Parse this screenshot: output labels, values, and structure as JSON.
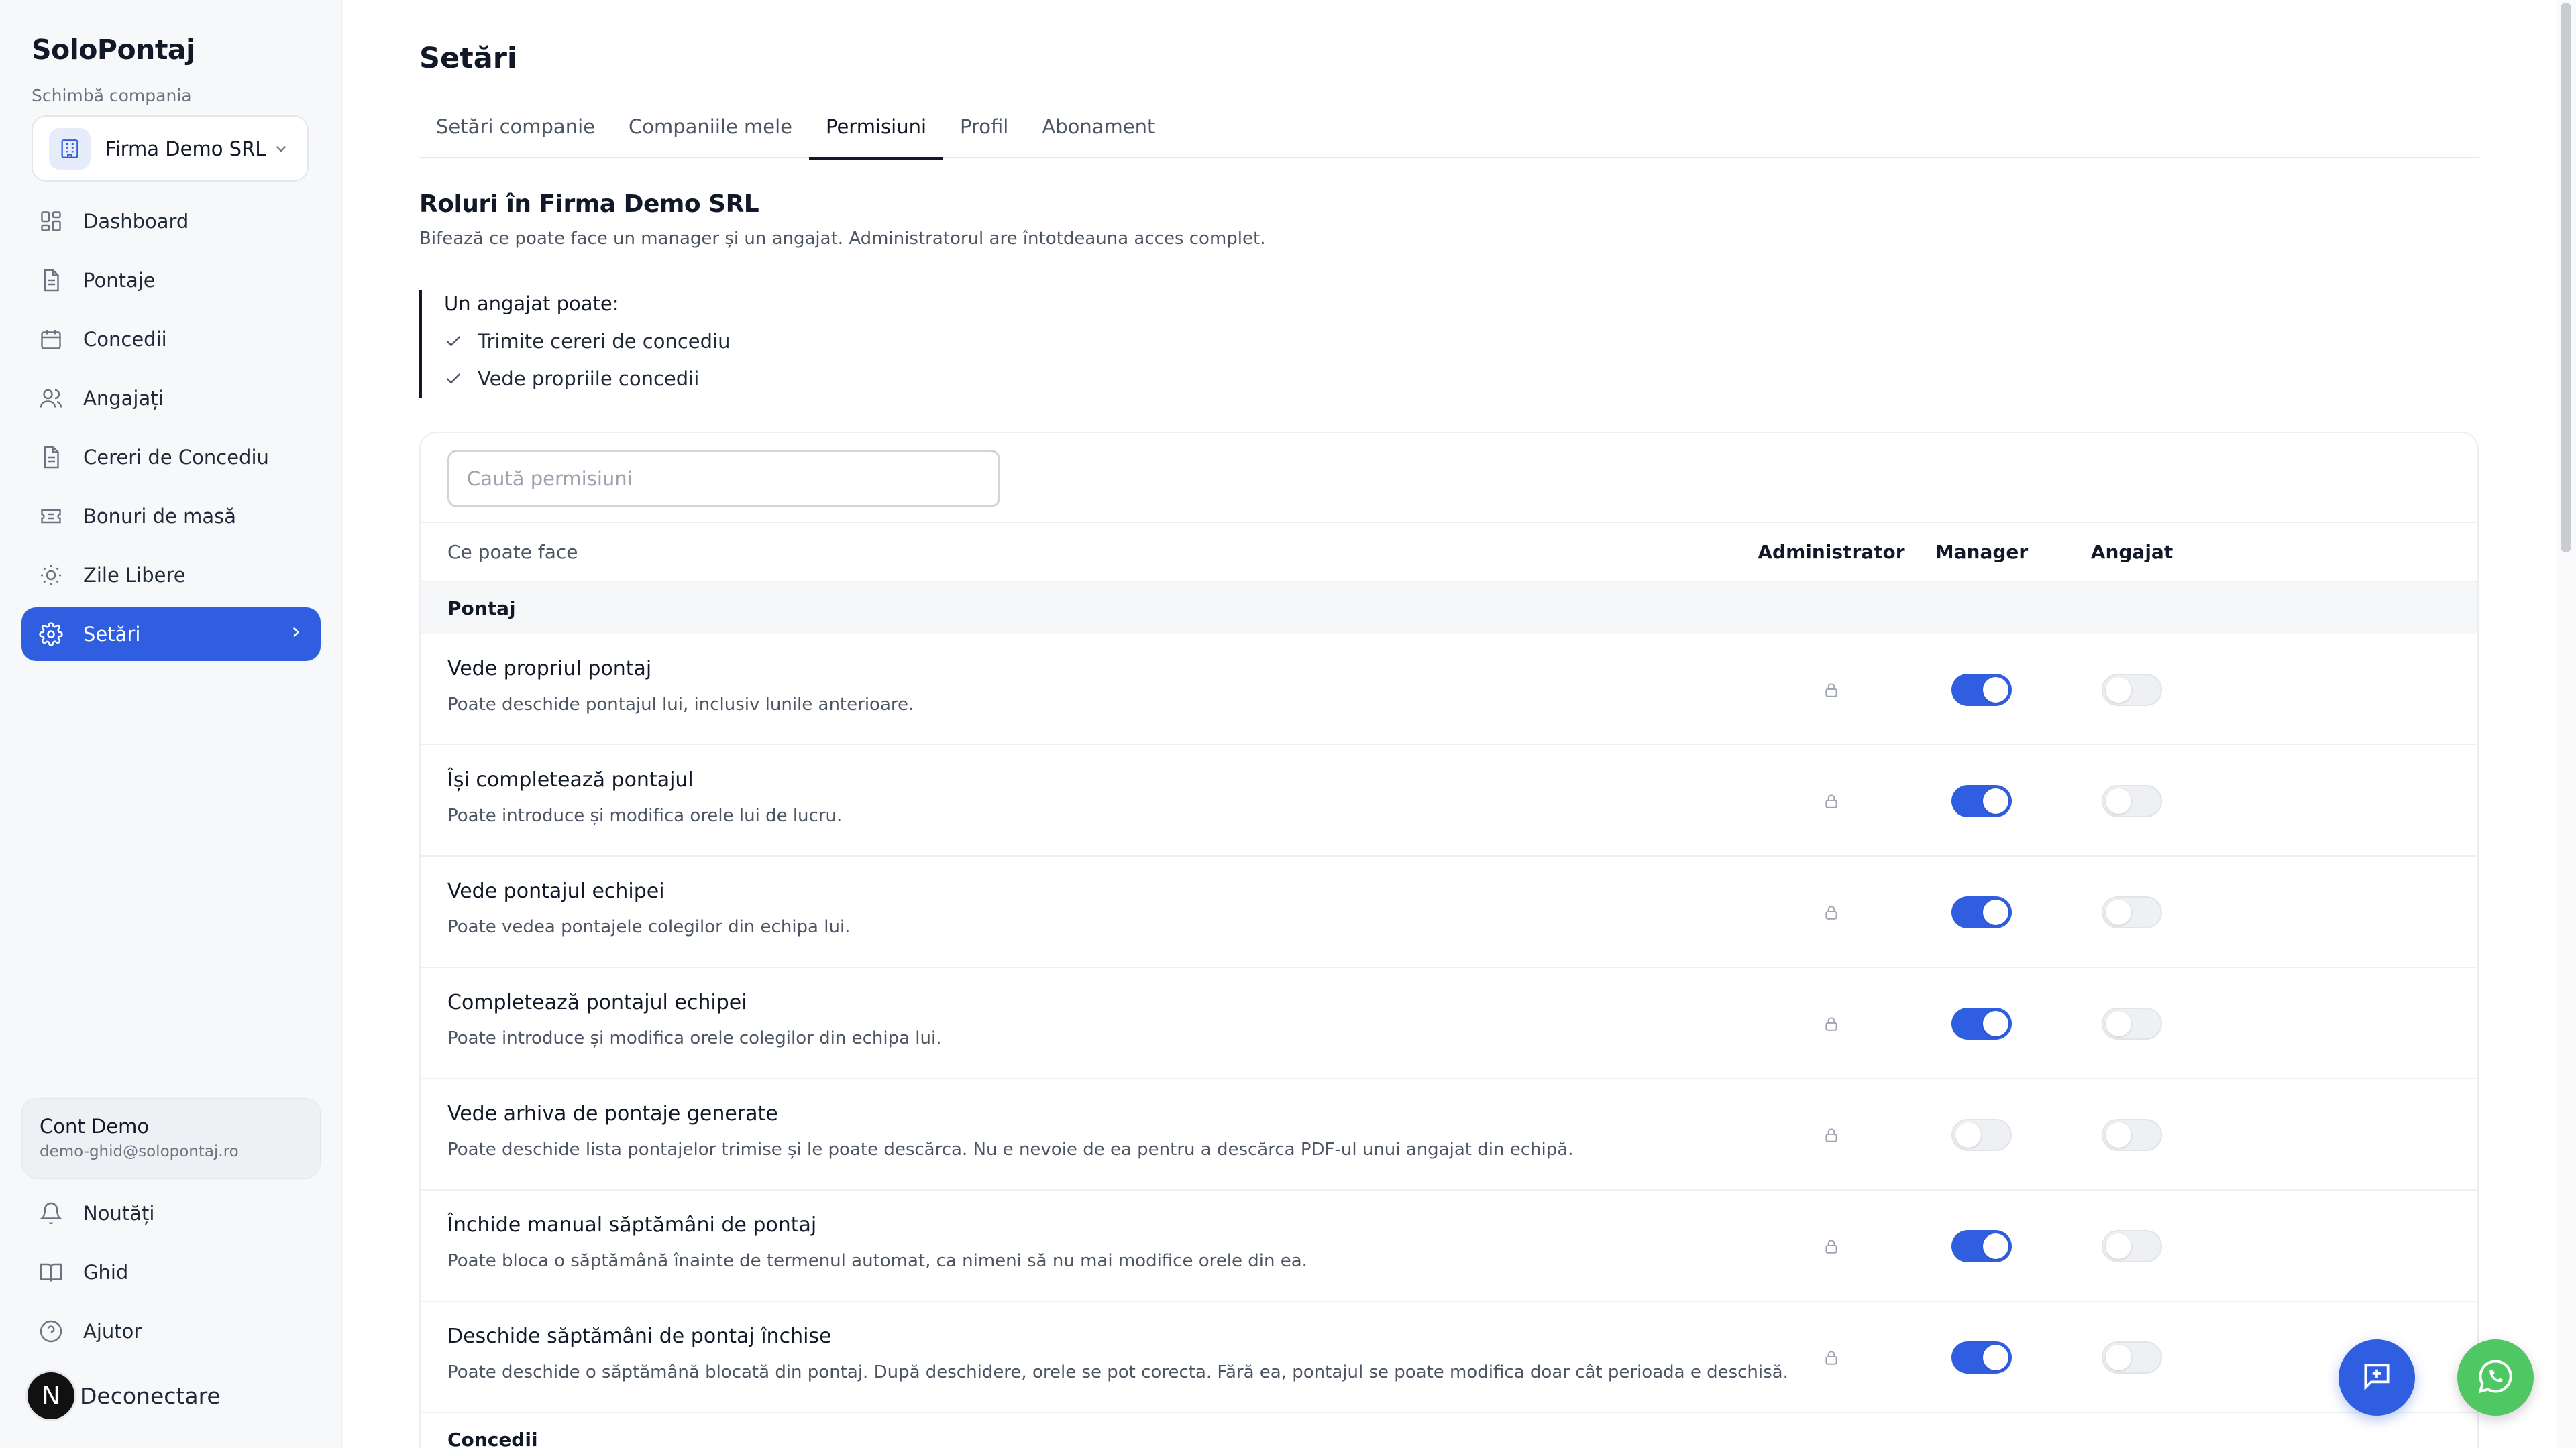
{
  "app": {
    "brand": "SoloPontaj",
    "company_caption": "Schimbă compania",
    "company_name": "Firma Demo SRL"
  },
  "sidebar": {
    "items": [
      {
        "label": "Dashboard",
        "icon": "dashboard-icon"
      },
      {
        "label": "Pontaje",
        "icon": "document-icon"
      },
      {
        "label": "Concedii",
        "icon": "calendar-icon"
      },
      {
        "label": "Angajați",
        "icon": "users-icon"
      },
      {
        "label": "Cereri de Concediu",
        "icon": "document-icon"
      },
      {
        "label": "Bonuri de masă",
        "icon": "ticket-icon"
      },
      {
        "label": "Zile Libere",
        "icon": "sun-icon"
      },
      {
        "label": "Setări",
        "icon": "gear-icon",
        "active": true
      }
    ],
    "account": {
      "name": "Cont Demo",
      "email": "demo-ghid@solopontaj.ro"
    },
    "bottom_items": [
      {
        "label": "Noutăți",
        "icon": "bell-icon"
      },
      {
        "label": "Ghid",
        "icon": "book-icon"
      },
      {
        "label": "Ajutor",
        "icon": "help-icon"
      }
    ],
    "logout": {
      "avatar_letter": "N",
      "label": "Deconectare"
    }
  },
  "main": {
    "title": "Setări",
    "tabs": [
      {
        "label": "Setări companie"
      },
      {
        "label": "Companiile mele"
      },
      {
        "label": "Permisiuni",
        "active": true
      },
      {
        "label": "Profil"
      },
      {
        "label": "Abonament"
      }
    ],
    "roles_title": "Roluri în Firma Demo SRL",
    "roles_desc": "Bifează ce poate face un manager și un angajat. Administratorul are întotdeauna acces complet.",
    "callout": {
      "title": "Un angajat poate:",
      "items": [
        "Trimite cereri de concediu",
        "Vede propriile concedii"
      ]
    },
    "search_placeholder": "Caută permisiuni",
    "table": {
      "header": {
        "what": "Ce poate face",
        "admin": "Administrator",
        "manager": "Manager",
        "angajat": "Angajat"
      },
      "section_pontaj": "Pontaj",
      "section_concedii": "Concedii",
      "rows": [
        {
          "title": "Vede propriul pontaj",
          "desc": "Poate deschide pontajul lui, inclusiv lunile anterioare.",
          "manager": true,
          "angajat": false
        },
        {
          "title": "Își completează pontajul",
          "desc": "Poate introduce și modifica orele lui de lucru.",
          "manager": true,
          "angajat": false
        },
        {
          "title": "Vede pontajul echipei",
          "desc": "Poate vedea pontajele colegilor din echipa lui.",
          "manager": true,
          "angajat": false
        },
        {
          "title": "Completează pontajul echipei",
          "desc": "Poate introduce și modifica orele colegilor din echipa lui.",
          "manager": true,
          "angajat": false
        },
        {
          "title": "Vede arhiva de pontaje generate",
          "desc": "Poate deschide lista pontajelor trimise și le poate descărca. Nu e nevoie de ea pentru a descărca PDF-ul unui angajat din echipă.",
          "manager": false,
          "angajat": false
        },
        {
          "title": "Închide manual săptămâni de pontaj",
          "desc": "Poate bloca o săptămână înainte de termenul automat, ca nimeni să nu mai modifice orele din ea.",
          "manager": true,
          "angajat": false
        },
        {
          "title": "Deschide săptămâni de pontaj închise",
          "desc": "Poate deschide o săptămână blocată din pontaj. După deschidere, orele se pot corecta. Fără ea, pontajul se poate modifica doar cât perioada e deschisă.",
          "manager": true,
          "angajat": false
        }
      ]
    }
  },
  "colors": {
    "accent": "#2f5fe0",
    "whatsapp": "#4fc864"
  }
}
